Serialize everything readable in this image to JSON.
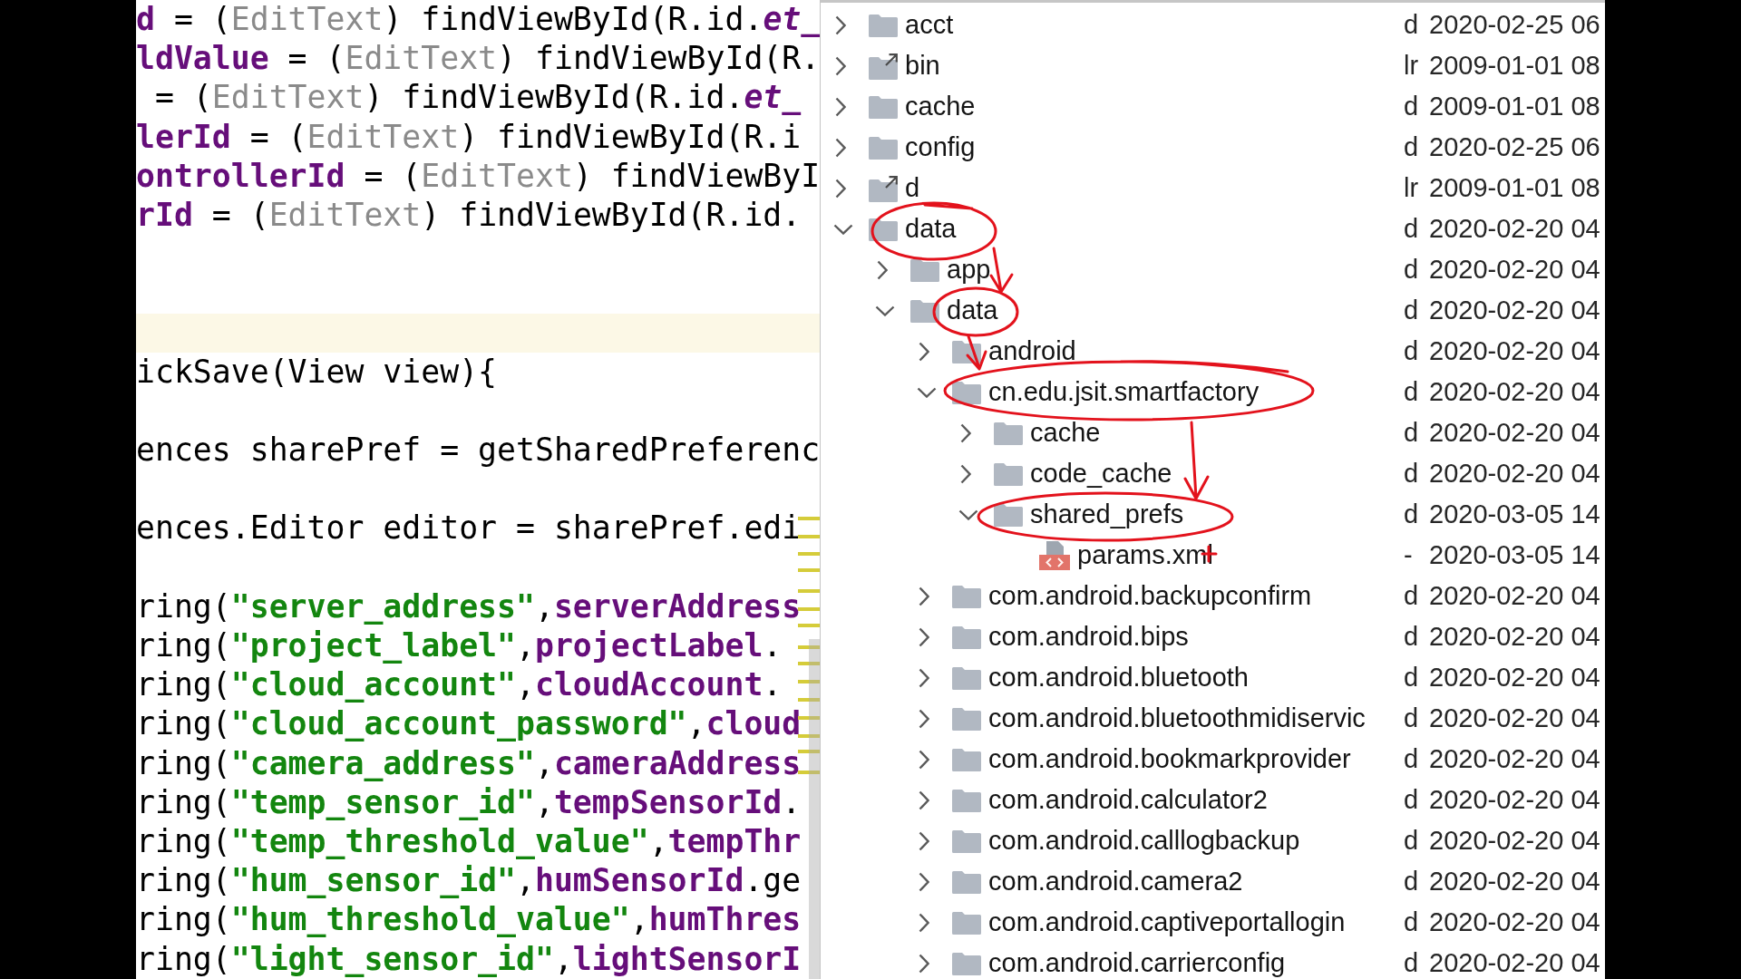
{
  "editor": {
    "lines": [
      {
        "kind": "code",
        "highlighted": false,
        "segments": [
          {
            "kind": "field",
            "text": "d"
          },
          {
            "kind": "plain",
            "text": " = ("
          },
          {
            "kind": "cast",
            "text": "EditText"
          },
          {
            "kind": "plain",
            "text": ") findViewById(R.id."
          },
          {
            "kind": "resource",
            "text": "et_"
          }
        ]
      },
      {
        "kind": "code",
        "highlighted": false,
        "segments": [
          {
            "kind": "field",
            "text": "ldValue"
          },
          {
            "kind": "plain",
            "text": " = ("
          },
          {
            "kind": "cast",
            "text": "EditText"
          },
          {
            "kind": "plain",
            "text": ") findViewById(R."
          }
        ]
      },
      {
        "kind": "code",
        "highlighted": false,
        "segments": [
          {
            "kind": "plain",
            "text": " = ("
          },
          {
            "kind": "cast",
            "text": "EditText"
          },
          {
            "kind": "plain",
            "text": ") findViewById(R.id."
          },
          {
            "kind": "resource",
            "text": "et_"
          }
        ]
      },
      {
        "kind": "code",
        "highlighted": false,
        "segments": [
          {
            "kind": "field",
            "text": "lerId"
          },
          {
            "kind": "plain",
            "text": " = ("
          },
          {
            "kind": "cast",
            "text": "EditText"
          },
          {
            "kind": "plain",
            "text": ") findViewById(R.i"
          }
        ]
      },
      {
        "kind": "code",
        "highlighted": false,
        "segments": [
          {
            "kind": "field",
            "text": "ontrollerId"
          },
          {
            "kind": "plain",
            "text": " = ("
          },
          {
            "kind": "cast",
            "text": "EditText"
          },
          {
            "kind": "plain",
            "text": ") findViewByI"
          }
        ]
      },
      {
        "kind": "code",
        "highlighted": false,
        "segments": [
          {
            "kind": "field",
            "text": "rId"
          },
          {
            "kind": "plain",
            "text": " = ("
          },
          {
            "kind": "cast",
            "text": "EditText"
          },
          {
            "kind": "plain",
            "text": ") findViewById(R.id."
          }
        ]
      },
      {
        "kind": "blank",
        "highlighted": false
      },
      {
        "kind": "blank",
        "highlighted": false
      },
      {
        "kind": "blank",
        "highlighted": true
      },
      {
        "kind": "code",
        "highlighted": false,
        "segments": [
          {
            "kind": "plain",
            "text": "ickSave(View view){"
          }
        ]
      },
      {
        "kind": "blank",
        "highlighted": false
      },
      {
        "kind": "code",
        "highlighted": false,
        "segments": [
          {
            "kind": "plain",
            "text": "ences sharePref = getSharedPreferenc"
          }
        ]
      },
      {
        "kind": "blank",
        "highlighted": false
      },
      {
        "kind": "code",
        "highlighted": false,
        "segments": [
          {
            "kind": "plain",
            "text": "ences.Editor editor = sharePref.edi"
          }
        ]
      },
      {
        "kind": "blank",
        "highlighted": false
      },
      {
        "kind": "code",
        "highlighted": false,
        "segments": [
          {
            "kind": "plain",
            "text": "ring("
          },
          {
            "kind": "string",
            "text": "\"server_address\""
          },
          {
            "kind": "field",
            "lead": ",",
            "text": "serverAddress"
          }
        ]
      },
      {
        "kind": "code",
        "highlighted": false,
        "segments": [
          {
            "kind": "plain",
            "text": "ring("
          },
          {
            "kind": "string",
            "text": "\"project_label\""
          },
          {
            "kind": "field",
            "lead": ",",
            "text": "projectLabel"
          },
          {
            "kind": "plain",
            "text": "."
          }
        ]
      },
      {
        "kind": "code",
        "highlighted": false,
        "segments": [
          {
            "kind": "plain",
            "text": "ring("
          },
          {
            "kind": "string",
            "text": "\"cloud_account\""
          },
          {
            "kind": "field",
            "lead": ",",
            "text": "cloudAccount"
          },
          {
            "kind": "plain",
            "text": "."
          }
        ]
      },
      {
        "kind": "code",
        "highlighted": false,
        "segments": [
          {
            "kind": "plain",
            "text": "ring("
          },
          {
            "kind": "string",
            "text": "\"cloud_account_password\""
          },
          {
            "kind": "field",
            "lead": ",",
            "text": "cloud"
          }
        ]
      },
      {
        "kind": "code",
        "highlighted": false,
        "segments": [
          {
            "kind": "plain",
            "text": "ring("
          },
          {
            "kind": "string",
            "text": "\"camera_address\""
          },
          {
            "kind": "field",
            "lead": ",",
            "text": "cameraAddress"
          }
        ]
      },
      {
        "kind": "code",
        "highlighted": false,
        "segments": [
          {
            "kind": "plain",
            "text": "ring("
          },
          {
            "kind": "string",
            "text": "\"temp_sensor_id\""
          },
          {
            "kind": "field",
            "lead": ",",
            "text": "tempSensorId"
          },
          {
            "kind": "plain",
            "text": "."
          }
        ]
      },
      {
        "kind": "code",
        "highlighted": false,
        "segments": [
          {
            "kind": "plain",
            "text": "ring("
          },
          {
            "kind": "string",
            "text": "\"temp_threshold_value\""
          },
          {
            "kind": "field",
            "lead": ",",
            "text": "tempThr"
          }
        ]
      },
      {
        "kind": "code",
        "highlighted": false,
        "segments": [
          {
            "kind": "plain",
            "text": "ring("
          },
          {
            "kind": "string",
            "text": "\"hum_sensor_id\""
          },
          {
            "kind": "field",
            "lead": ",",
            "text": "humSensorId"
          },
          {
            "kind": "plain",
            "text": ".ge"
          }
        ]
      },
      {
        "kind": "code",
        "highlighted": false,
        "segments": [
          {
            "kind": "plain",
            "text": "ring("
          },
          {
            "kind": "string",
            "text": "\"hum_threshold_value\""
          },
          {
            "kind": "field",
            "lead": ",",
            "text": "humThres"
          }
        ]
      },
      {
        "kind": "code",
        "highlighted": false,
        "segments": [
          {
            "kind": "plain",
            "text": "ring("
          },
          {
            "kind": "string",
            "text": "\"light_sensor_id\""
          },
          {
            "kind": "field",
            "lead": ",",
            "text": "lightSensorI"
          }
        ]
      }
    ]
  },
  "file_tree": {
    "nodes": [
      {
        "name": "acct",
        "kind": "folder",
        "expanded": false,
        "column_2": "d",
        "column_3": "2020-02-25 06"
      },
      {
        "name": "bin",
        "kind": "link",
        "expanded": false,
        "column_2": "lr",
        "column_3": "2009-01-01 08"
      },
      {
        "name": "cache",
        "kind": "folder",
        "expanded": false,
        "column_2": "d",
        "column_3": "2009-01-01 08"
      },
      {
        "name": "config",
        "kind": "folder",
        "expanded": false,
        "column_2": "d",
        "column_3": "2020-02-25 06"
      },
      {
        "name": "d",
        "kind": "link",
        "expanded": false,
        "column_2": "lr",
        "column_3": "2009-01-01 08"
      },
      {
        "name": "data",
        "kind": "folder",
        "expanded": true,
        "column_2": "d",
        "column_3": "2020-02-20 04",
        "children": [
          {
            "name": "app",
            "kind": "folder",
            "expanded": false,
            "column_2": "d",
            "column_3": "2020-02-20 04"
          },
          {
            "name": "data",
            "kind": "folder",
            "expanded": true,
            "column_2": "d",
            "column_3": "2020-02-20 04",
            "children": [
              {
                "name": "android",
                "kind": "folder",
                "expanded": false,
                "column_2": "d",
                "column_3": "2020-02-20 04"
              },
              {
                "name": "cn.edu.jsit.smartfactory",
                "kind": "folder",
                "expanded": true,
                "column_2": "d",
                "column_3": "2020-02-20 04",
                "children": [
                  {
                    "name": "cache",
                    "kind": "folder",
                    "expanded": false,
                    "column_2": "d",
                    "column_3": "2020-02-20 04"
                  },
                  {
                    "name": "code_cache",
                    "kind": "folder",
                    "expanded": false,
                    "column_2": "d",
                    "column_3": "2020-02-20 04"
                  },
                  {
                    "name": "shared_prefs",
                    "kind": "folder",
                    "expanded": true,
                    "column_2": "d",
                    "column_3": "2020-03-05 14",
                    "children": [
                      {
                        "name": "params.xml",
                        "kind": "file",
                        "column_2": "-",
                        "column_3": "2020-03-05 14"
                      }
                    ]
                  }
                ]
              },
              {
                "name": "com.android.backupconfirm",
                "kind": "folder",
                "expanded": false,
                "column_2": "d",
                "column_3": "2020-02-20 04"
              },
              {
                "name": "com.android.bips",
                "kind": "folder",
                "expanded": false,
                "column_2": "d",
                "column_3": "2020-02-20 04"
              },
              {
                "name": "com.android.bluetooth",
                "kind": "folder",
                "expanded": false,
                "column_2": "d",
                "column_3": "2020-02-20 04"
              },
              {
                "name": "com.android.bluetoothmidiservic",
                "kind": "folder",
                "expanded": false,
                "column_2": "d",
                "column_3": "2020-02-20 04"
              },
              {
                "name": "com.android.bookmarkprovider",
                "kind": "folder",
                "expanded": false,
                "column_2": "d",
                "column_3": "2020-02-20 04"
              },
              {
                "name": "com.android.calculator2",
                "kind": "folder",
                "expanded": false,
                "column_2": "d",
                "column_3": "2020-02-20 04"
              },
              {
                "name": "com.android.calllogbackup",
                "kind": "folder",
                "expanded": false,
                "column_2": "d",
                "column_3": "2020-02-20 04"
              },
              {
                "name": "com.android.camera2",
                "kind": "folder",
                "expanded": false,
                "column_2": "d",
                "column_3": "2020-02-20 04"
              },
              {
                "name": "com.android.captiveportallogin",
                "kind": "folder",
                "expanded": false,
                "column_2": "d",
                "column_3": "2020-02-20 04"
              },
              {
                "name": "com.android.carrierconfig",
                "kind": "folder",
                "expanded": false,
                "column_2": "d",
                "column_3": "2020-02-20 04"
              }
            ]
          }
        ]
      }
    ]
  }
}
